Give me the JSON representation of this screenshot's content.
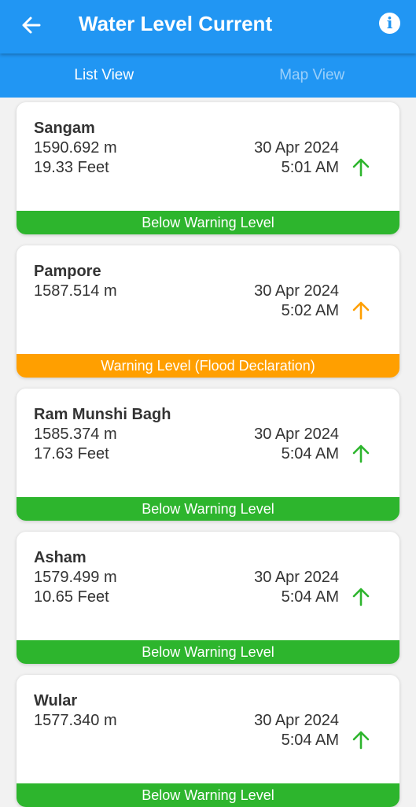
{
  "header": {
    "title": "Water Level Current",
    "back_icon": "back-arrow-icon",
    "info_icon": "info-icon"
  },
  "tabs": [
    {
      "label": "List View",
      "active": true
    },
    {
      "label": "Map View",
      "active": false
    }
  ],
  "colors": {
    "primary": "#2196f3",
    "green": "#2db52d",
    "orange": "#ff9f00"
  },
  "stations": [
    {
      "name": "Sangam",
      "meters": "1590.692  m",
      "feet": "19.33 Feet",
      "date": "30 Apr 2024",
      "time": "5:01 AM",
      "trend": "up",
      "status": "Below Warning Level",
      "status_color": "#2db52d"
    },
    {
      "name": "Pampore",
      "meters": "1587.514  m",
      "feet": "",
      "date": "30 Apr 2024",
      "time": "5:02 AM",
      "trend": "up",
      "status": "Warning Level (Flood Declaration)",
      "status_color": "#ff9f00"
    },
    {
      "name": "Ram Munshi Bagh",
      "meters": "1585.374  m",
      "feet": "17.63 Feet",
      "date": "30 Apr 2024",
      "time": "5:04 AM",
      "trend": "up",
      "status": "Below Warning Level",
      "status_color": "#2db52d"
    },
    {
      "name": "Asham",
      "meters": "1579.499  m",
      "feet": "10.65 Feet",
      "date": "30 Apr 2024",
      "time": "5:04 AM",
      "trend": "up",
      "status": "Below Warning Level",
      "status_color": "#2db52d"
    },
    {
      "name": "Wular",
      "meters": "1577.340  m",
      "feet": "",
      "date": "30 Apr 2024",
      "time": "5:04 AM",
      "trend": "up",
      "status": "Below Warning Level",
      "status_color": "#2db52d"
    }
  ]
}
